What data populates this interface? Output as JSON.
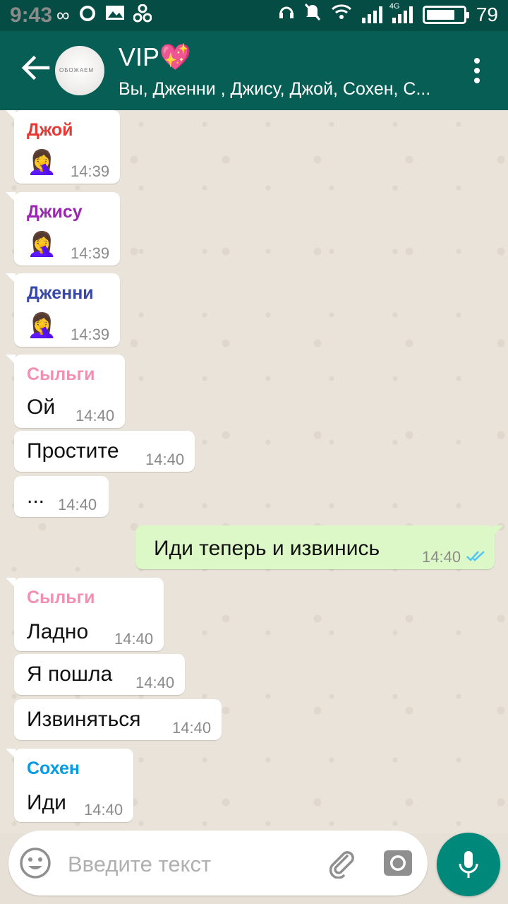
{
  "status": {
    "time": "9:43",
    "battery": "79",
    "network": "4G",
    "battery_level": 0.79
  },
  "header": {
    "title": "VIP💖",
    "subtitle": "Вы, Дженни , Джису, Джой, Сохен, С...",
    "avatar_text": "ОБОЖАЕМ"
  },
  "messages": [
    {
      "sender": "Джой",
      "sender_color": "#e53935",
      "emoji": "🤦‍♀️",
      "time": "14:39"
    },
    {
      "sender": "Джису",
      "sender_color": "#9c27b0",
      "emoji": "🤦‍♀️",
      "time": "14:39"
    },
    {
      "sender": "Дженни",
      "sender_color": "#3949ab",
      "emoji": "🤦‍♀️",
      "time": "14:39"
    },
    {
      "sender": "Сыльги",
      "sender_color": "#f48fb1",
      "text": "Ой",
      "time": "14:40"
    },
    {
      "text": "Простите",
      "time": "14:40"
    },
    {
      "text": "...",
      "time": "14:40"
    },
    {
      "text": "Иди теперь и извинись",
      "time": "14:40",
      "outgoing": true
    },
    {
      "sender": "Сыльги",
      "sender_color": "#f48fb1",
      "text": "Ладно",
      "time": "14:40"
    },
    {
      "text": "Я пошла",
      "time": "14:40"
    },
    {
      "text": "Извиняться",
      "time": "14:40"
    },
    {
      "sender": "Сохен",
      "sender_color": "#039be5",
      "text": "Иди",
      "time": "14:40"
    }
  ],
  "input": {
    "placeholder": "Введите текст"
  },
  "colors": {
    "header": "#075e54",
    "statusbar": "#054d44",
    "outgoing_bubble": "#dcf8c6",
    "accent": "#00897b",
    "tick_blue": "#4fc3f7"
  }
}
